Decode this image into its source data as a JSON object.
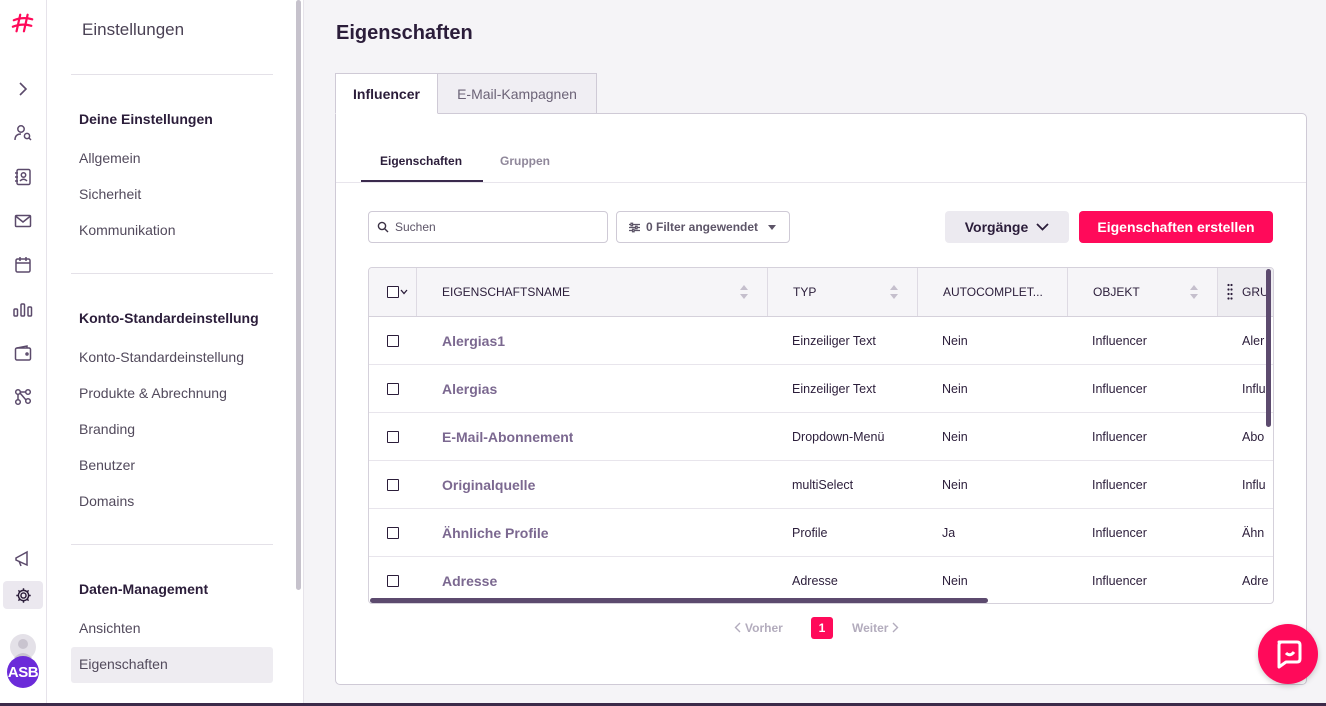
{
  "sidebar": {
    "title": "Einstellungen",
    "sections": [
      {
        "heading": "Deine Einstellungen",
        "items": [
          "Allgemein",
          "Sicherheit",
          "Kommunikation"
        ]
      },
      {
        "heading": "Konto-Standardeinstellung",
        "items": [
          "Konto-Standardeinstellung",
          "Produkte & Abrechnung",
          "Branding",
          "Benutzer",
          "Domains"
        ]
      },
      {
        "heading": "Daten-Management",
        "items": [
          "Ansichten",
          "Eigenschaften"
        ]
      }
    ],
    "selected": "Eigenschaften"
  },
  "rail": {
    "avatar_initials": "ASB"
  },
  "main": {
    "title": "Eigenschaften",
    "tabs": [
      "Influencer",
      "E-Mail-Kampagnen"
    ],
    "active_tab": "Influencer",
    "subtabs": [
      "Eigenschaften",
      "Gruppen"
    ],
    "active_subtab": "Eigenschaften",
    "search_placeholder": "Suchen",
    "filter_label": "0 Filter angewendet",
    "ops_label": "Vorgänge",
    "create_label": "Eigenschaften erstellen"
  },
  "table": {
    "columns": [
      "EIGENSCHAFTSNAME",
      "TYP",
      "AUTOCOMPLET...",
      "OBJEKT",
      "GRU"
    ],
    "rows": [
      {
        "name": "Alergias1",
        "type": "Einzeiliger Text",
        "autocomplete": "Nein",
        "object": "Influencer",
        "group": "Aler"
      },
      {
        "name": "Alergias",
        "type": "Einzeiliger Text",
        "autocomplete": "Nein",
        "object": "Influencer",
        "group": "Influ"
      },
      {
        "name": "E-Mail-Abonnement",
        "type": "Dropdown-Menü",
        "autocomplete": "Nein",
        "object": "Influencer",
        "group": "Abo"
      },
      {
        "name": "Originalquelle",
        "type": "multiSelect",
        "autocomplete": "Nein",
        "object": "Influencer",
        "group": "Influ"
      },
      {
        "name": "Ähnliche Profile",
        "type": "Profile",
        "autocomplete": "Ja",
        "object": "Influencer",
        "group": "Ähn"
      },
      {
        "name": "Adresse",
        "type": "Adresse",
        "autocomplete": "Nein",
        "object": "Influencer",
        "group": "Adre"
      }
    ]
  },
  "pagination": {
    "prev": "Vorher",
    "current": "1",
    "next": "Weiter"
  },
  "colors": {
    "accent": "#ff0a5a",
    "dark": "#2b1d3a",
    "avatar": "#6b2bd9"
  }
}
